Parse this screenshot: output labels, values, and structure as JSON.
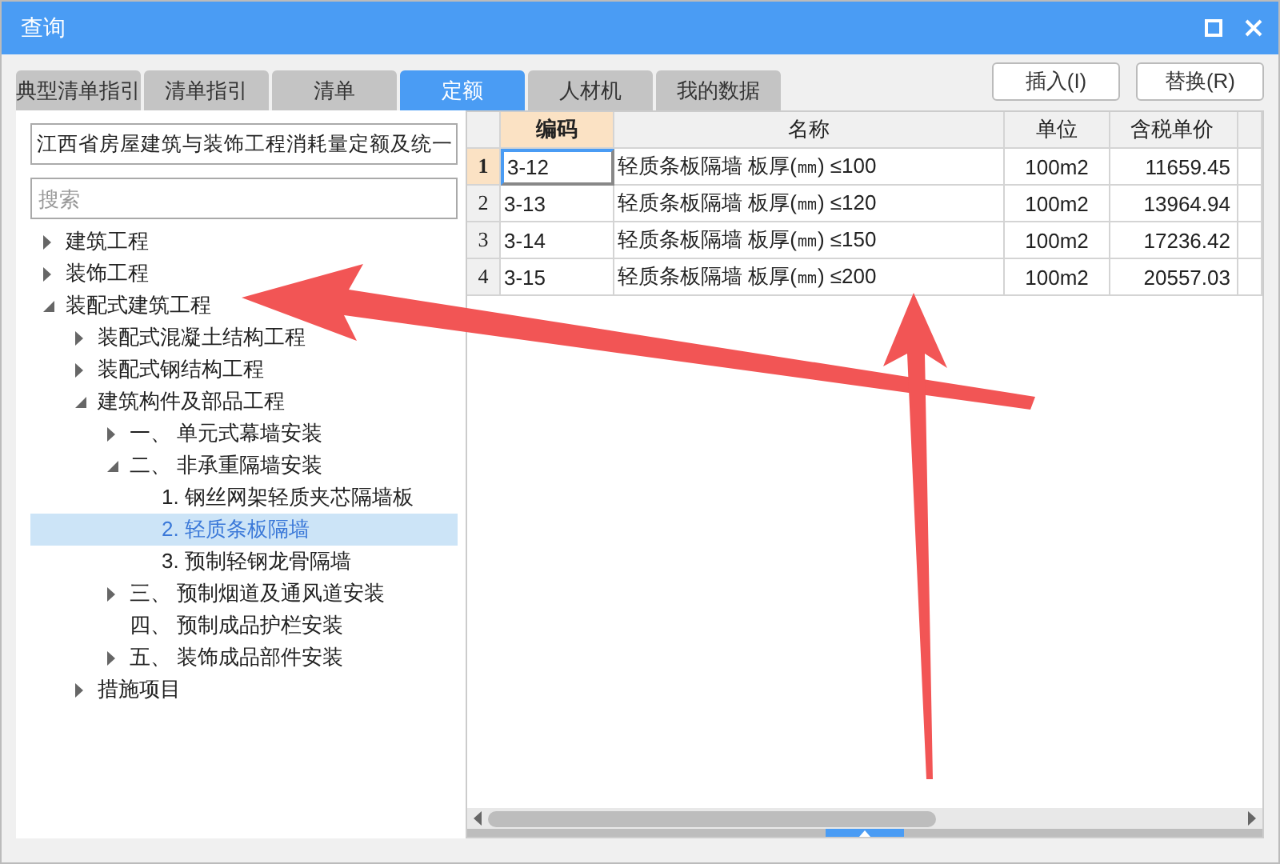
{
  "window": {
    "title": "查询"
  },
  "tabs": [
    {
      "label": "典型清单指引",
      "selected": false
    },
    {
      "label": "清单指引",
      "selected": false
    },
    {
      "label": "清单",
      "selected": false
    },
    {
      "label": "定额",
      "selected": true
    },
    {
      "label": "人材机",
      "selected": false
    },
    {
      "label": "我的数据",
      "selected": false
    }
  ],
  "buttons": [
    "插入(I)",
    "替换(R)"
  ],
  "library_select": {
    "value": "江西省房屋建筑与装饰工程消耗量定额及统一"
  },
  "search": {
    "placeholder": "搜索"
  },
  "tree": [
    {
      "label": "建筑工程",
      "kind": "branch",
      "expanded": false,
      "selected": false
    },
    {
      "label": "装饰工程",
      "kind": "branch",
      "expanded": false,
      "selected": false
    },
    {
      "label": "装配式建筑工程",
      "kind": "branch",
      "expanded": true,
      "selected": false,
      "children": [
        {
          "label": "装配式混凝土结构工程",
          "kind": "branch",
          "expanded": false,
          "selected": false
        },
        {
          "label": "装配式钢结构工程",
          "kind": "branch",
          "expanded": false,
          "selected": false
        },
        {
          "label": "建筑构件及部品工程",
          "kind": "branch",
          "expanded": true,
          "selected": false,
          "children": [
            {
              "label": "一、 单元式幕墙安装",
              "kind": "branch",
              "expanded": false,
              "selected": false
            },
            {
              "label": "二、 非承重隔墙安装",
              "kind": "branch",
              "expanded": true,
              "selected": false,
              "children": [
                {
                  "label": "1. 钢丝网架轻质夹芯隔墙板",
                  "kind": "leaf",
                  "selected": false
                },
                {
                  "label": "2. 轻质条板隔墙",
                  "kind": "leaf",
                  "selected": true
                },
                {
                  "label": "3. 预制轻钢龙骨隔墙",
                  "kind": "leaf",
                  "selected": false
                }
              ]
            },
            {
              "label": "三、 预制烟道及通风道安装",
              "kind": "branch",
              "expanded": false,
              "selected": false
            },
            {
              "label": "四、 预制成品护栏安装",
              "kind": "leaf",
              "selected": false
            },
            {
              "label": "五、 装饰成品部件安装",
              "kind": "branch",
              "expanded": false,
              "selected": false
            }
          ]
        },
        {
          "label": "措施项目",
          "kind": "branch",
          "expanded": false,
          "selected": false
        }
      ]
    }
  ],
  "table": {
    "columns": [
      "编码",
      "名称",
      "单位",
      "含税单价"
    ],
    "rows": [
      {
        "number": "1",
        "code": "3-12",
        "name": "轻质条板隔墙 板厚(㎜) ≤100",
        "unit": "100m2",
        "price": "11659.45",
        "selected": true
      },
      {
        "number": "2",
        "code": "3-13",
        "name": "轻质条板隔墙 板厚(㎜) ≤120",
        "unit": "100m2",
        "price": "13964.94",
        "selected": false
      },
      {
        "number": "3",
        "code": "3-14",
        "name": "轻质条板隔墙 板厚(㎜) ≤150",
        "unit": "100m2",
        "price": "17236.42",
        "selected": false
      },
      {
        "number": "4",
        "code": "3-15",
        "name": "轻质条板隔墙 板厚(㎜) ≤200",
        "unit": "100m2",
        "price": "20557.03",
        "selected": false
      }
    ]
  }
}
